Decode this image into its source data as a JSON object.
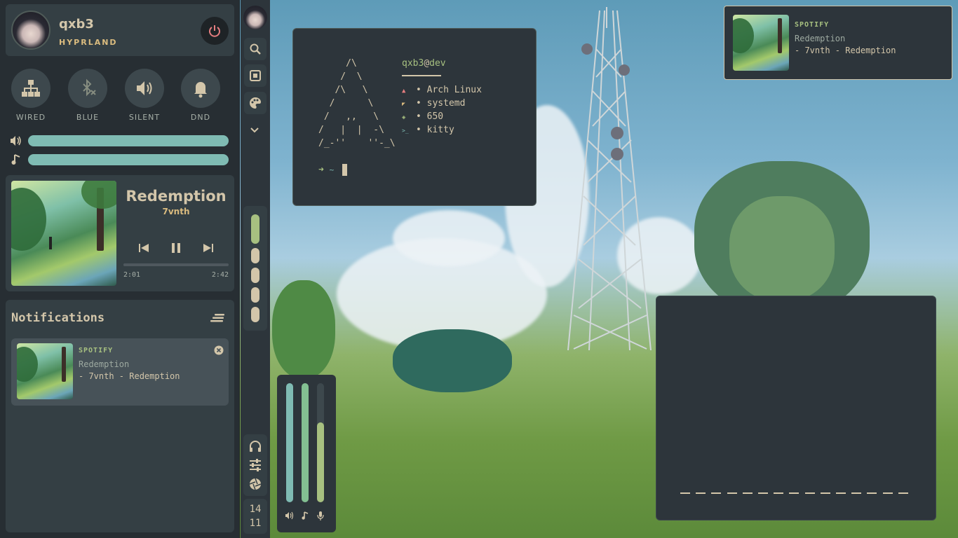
{
  "profile": {
    "username": "qxb3",
    "subtitle": "HYPRLAND"
  },
  "toggles": [
    {
      "label": "WIRED",
      "icon": "network-icon"
    },
    {
      "label": "BLUE",
      "icon": "bluetooth-off-icon"
    },
    {
      "label": "SILENT",
      "icon": "volume-icon"
    },
    {
      "label": "DND",
      "icon": "bell-icon"
    }
  ],
  "sliders": {
    "volume_level": 1.0,
    "music_level": 1.0
  },
  "player": {
    "title": "Redemption",
    "artist": "7vnth",
    "elapsed": "2:01",
    "duration": "2:42",
    "progress": 0.75
  },
  "notifications": {
    "heading": "Notifications",
    "items": [
      {
        "app": "SPOTIFY",
        "title": "Redemption",
        "body": "- 7vnth - Redemption"
      }
    ]
  },
  "dock": {
    "clock_hour": "14",
    "clock_minute": "11"
  },
  "terminal": {
    "user": "qxb3",
    "at": "@",
    "host": "dev",
    "ascii_logo": "     /\\\n    /  \\\n   /\\   \\\n  /      \\\n /   ,,   \\\n/   |  |  -\\\n/_-''    ''-_\\",
    "info": [
      {
        "icon": "arch-icon",
        "value": "• Arch Linux"
      },
      {
        "icon": "init-icon",
        "value": "• systemd"
      },
      {
        "icon": "package-icon",
        "value": "• 650"
      },
      {
        "icon": "terminal-icon",
        "value": "• kitty"
      }
    ],
    "prompt_dir": "~"
  },
  "popup": {
    "app": "SPOTIFY",
    "title": "Redemption",
    "body": "- 7vnth - Redemption"
  },
  "mixer": {
    "levels": [
      1.0,
      1.0,
      0.67
    ]
  },
  "colors": {
    "accent": "#a7c080",
    "teal": "#7fbbb3",
    "bg": "#2d353b",
    "red": "#e67e80",
    "fg": "#d3c6aa"
  }
}
